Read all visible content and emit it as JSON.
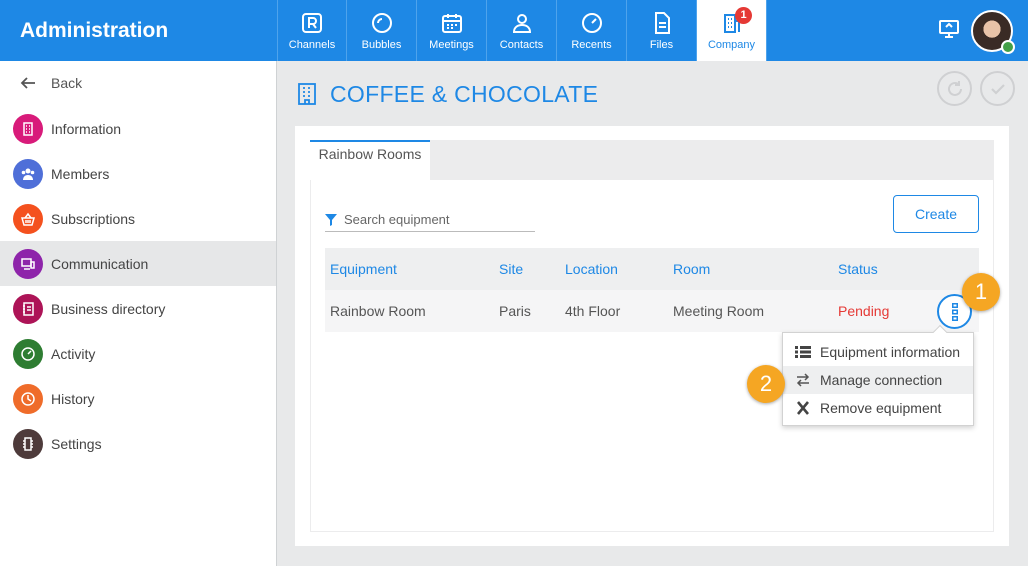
{
  "header": {
    "title": "Administration",
    "nav": [
      {
        "label": "Channels",
        "icon": "channels-icon"
      },
      {
        "label": "Bubbles",
        "icon": "bubbles-icon"
      },
      {
        "label": "Meetings",
        "icon": "calendar-icon"
      },
      {
        "label": "Contacts",
        "icon": "contacts-icon"
      },
      {
        "label": "Recents",
        "icon": "clock-icon"
      },
      {
        "label": "Files",
        "icon": "file-icon"
      },
      {
        "label": "Company",
        "icon": "building-icon",
        "badge": "1",
        "active": true
      }
    ],
    "accent": "#1e88e5"
  },
  "sidebar": {
    "back_label": "Back",
    "items": [
      {
        "label": "Information",
        "color": "#d81b7a"
      },
      {
        "label": "Members",
        "color": "#4f6fd8"
      },
      {
        "label": "Subscriptions",
        "color": "#f4511e"
      },
      {
        "label": "Communication",
        "color": "#8e24aa",
        "active": true
      },
      {
        "label": "Business directory",
        "color": "#ad1457"
      },
      {
        "label": "Activity",
        "color": "#2e7d32"
      },
      {
        "label": "History",
        "color": "#ef6c2a"
      },
      {
        "label": "Settings",
        "color": "#4e3b3b"
      }
    ]
  },
  "main": {
    "page_title": "COFFEE & CHOCOLATE",
    "tab_label": "Rainbow Rooms",
    "search_placeholder": "Search equipment",
    "create_label": "Create",
    "columns": [
      "Equipment",
      "Site",
      "Location",
      "Room",
      "Status"
    ],
    "rows": [
      {
        "equipment": "Rainbow Room",
        "site": "Paris",
        "location": "4th Floor",
        "room": "Meeting Room",
        "status": "Pending"
      }
    ],
    "status_color": "#e53935",
    "menu": [
      {
        "label": "Equipment information",
        "icon": "list-icon"
      },
      {
        "label": "Manage connection",
        "icon": "swap-arrows-icon"
      },
      {
        "label": "Remove equipment",
        "icon": "x-icon"
      }
    ]
  },
  "callouts": [
    "1",
    "2"
  ]
}
